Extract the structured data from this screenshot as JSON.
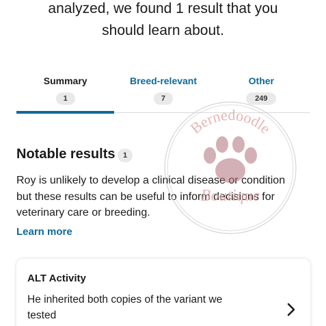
{
  "intro": {
    "line1": "analyzed, we found 1 result that you",
    "line2": "should learn about."
  },
  "tabs": [
    {
      "label": "Summary",
      "count": "1",
      "active": true
    },
    {
      "label": "Breed-relevant",
      "count": "7",
      "active": false
    },
    {
      "label": "Other",
      "count": "249",
      "active": false
    }
  ],
  "notable": {
    "title": "Notable results",
    "count": "1",
    "body_line1": "Roy is unlikely to develop a clinical disease or condition",
    "body_line2": "but these results can be useful to inform decisions for",
    "body_line3": "veterinary care or breeding.",
    "learn_more": "Learn more"
  },
  "result_card": {
    "title": "ALT Activity",
    "desc_line1": "He inherited both copies of the variant we",
    "desc_line2": "tested",
    "chevron_icon": "chevron-right-icon"
  },
  "watermark": {
    "top_text": "Bernedoodle",
    "bottom_text": "Boutique",
    "icon": "paw-print-icon"
  },
  "colors": {
    "accent": "#0f6a96",
    "badge_bg": "#e9e9e9",
    "watermark": "#d98c8c"
  }
}
